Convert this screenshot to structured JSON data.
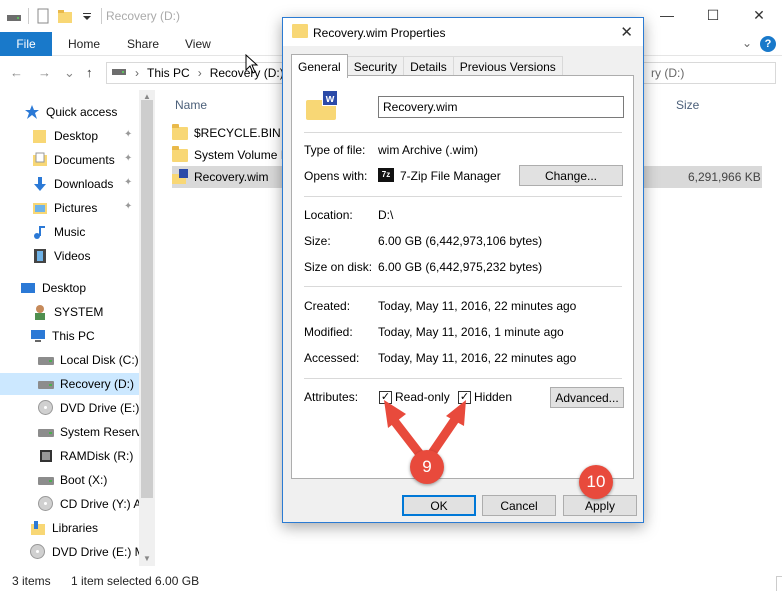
{
  "window": {
    "title": "Recovery (D:)",
    "controls": {
      "minimize": "—",
      "maximize": "☐",
      "close": "✕"
    }
  },
  "ribbon": {
    "file": "File",
    "tabs": [
      "Home",
      "Share",
      "View"
    ],
    "help": "?",
    "expand": "⌄"
  },
  "address": {
    "back": "←",
    "forward": "→",
    "recent": "⌄",
    "up": "↑",
    "path": [
      "This PC",
      "Recovery (D:)"
    ],
    "search_tail": "ry (D:)"
  },
  "nav": {
    "items": [
      {
        "label": "Quick access",
        "icon": "star-icon",
        "pinned": false
      },
      {
        "label": "Desktop",
        "icon": "folder-icon",
        "pinned": true
      },
      {
        "label": "Documents",
        "icon": "documents-icon",
        "pinned": true
      },
      {
        "label": "Downloads",
        "icon": "download-icon",
        "pinned": true
      },
      {
        "label": "Pictures",
        "icon": "pictures-icon",
        "pinned": true
      },
      {
        "label": "Music",
        "icon": "music-icon",
        "pinned": false
      },
      {
        "label": "Videos",
        "icon": "videos-icon",
        "pinned": false
      },
      {
        "label": "Desktop",
        "icon": "desktop-icon",
        "pinned": false
      },
      {
        "label": "SYSTEM",
        "icon": "user-icon",
        "pinned": false
      },
      {
        "label": "This PC",
        "icon": "computer-icon",
        "pinned": false
      },
      {
        "label": "Local Disk (C:)",
        "icon": "drive-icon",
        "pinned": false
      },
      {
        "label": "Recovery (D:)",
        "icon": "drive-icon",
        "pinned": false
      },
      {
        "label": "DVD Drive (E:) I",
        "icon": "disc-icon",
        "pinned": false
      },
      {
        "label": "System Reserve",
        "icon": "drive-icon",
        "pinned": false
      },
      {
        "label": "RAMDisk (R:)",
        "icon": "ramdisk-icon",
        "pinned": false
      },
      {
        "label": "Boot (X:)",
        "icon": "drive-icon",
        "pinned": false
      },
      {
        "label": "CD Drive (Y:) A",
        "icon": "cd-icon",
        "pinned": false
      },
      {
        "label": "Libraries",
        "icon": "libraries-icon",
        "pinned": false
      },
      {
        "label": "DVD Drive (E:) M",
        "icon": "disc-icon",
        "pinned": false
      }
    ],
    "pin_glyph": "📌"
  },
  "files": {
    "columns": {
      "name": "Name",
      "size": "Size"
    },
    "rows": [
      {
        "name": "$RECYCLE.BIN",
        "size": ""
      },
      {
        "name": "System Volume I",
        "size": ""
      },
      {
        "name": "Recovery.wim",
        "size": "6,291,966 KB"
      }
    ]
  },
  "status": {
    "items": "3 items",
    "selected": "1 item selected  6.00 GB"
  },
  "dialog": {
    "title": "Recovery.wim Properties",
    "close": "✕",
    "tabs": [
      "General",
      "Security",
      "Details",
      "Previous Versions"
    ],
    "badge_letter": "w",
    "filename": "Recovery.wim",
    "type_label": "Type of file:",
    "type_value": "wim Archive (.wim)",
    "opens_label": "Opens with:",
    "opens_value": "7-Zip File Manager",
    "zip_badge": "7z",
    "change_button": "Change...",
    "location_label": "Location:",
    "location_value": "D:\\",
    "size_label": "Size:",
    "size_value": "6.00 GB (6,442,973,106 bytes)",
    "sizeondisk_label": "Size on disk:",
    "sizeondisk_value": "6.00 GB (6,442,975,232 bytes)",
    "created_label": "Created:",
    "created_value": "Today, May 11, 2016, 22 minutes ago",
    "modified_label": "Modified:",
    "modified_value": "Today, May 11, 2016, 1 minute ago",
    "accessed_label": "Accessed:",
    "accessed_value": "Today, May 11, 2016, 22 minutes ago",
    "attributes_label": "Attributes:",
    "readonly_label": "Read-only",
    "hidden_label": "Hidden",
    "check_glyph": "✓",
    "advanced_button": "Advanced...",
    "ok_button": "OK",
    "cancel_button": "Cancel",
    "apply_button": "Apply"
  },
  "annotations": {
    "step9": "9",
    "step10": "10",
    "color": "#e84a3c"
  }
}
